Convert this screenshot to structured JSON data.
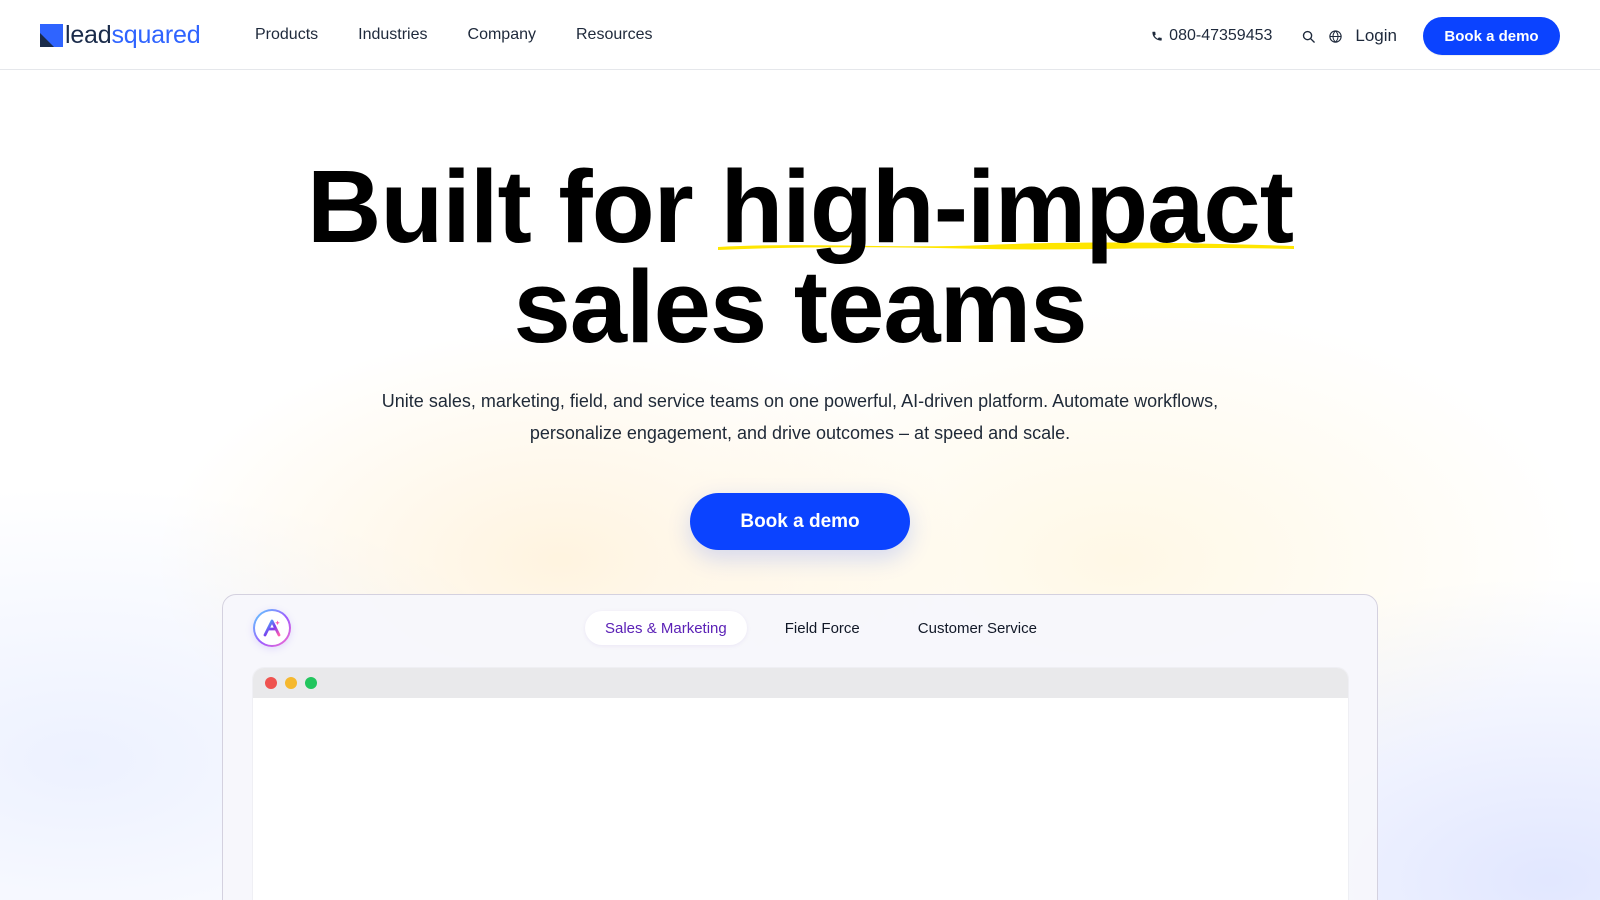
{
  "brand": {
    "logo_text_primary": "lead",
    "logo_text_secondary": "squared",
    "colors": {
      "navy": "#1a2b4a",
      "blue": "#2f64ff",
      "accent": "#0b43ff",
      "highlight": "#ffe600",
      "purple": "#5b21b6"
    }
  },
  "navbar": {
    "menu": [
      {
        "label": "Products"
      },
      {
        "label": "Industries"
      },
      {
        "label": "Company"
      },
      {
        "label": "Resources"
      }
    ],
    "phone_icon": "phone-icon",
    "phone_number": "080-47359453",
    "search_icon": "search-icon",
    "globe_icon": "globe-icon",
    "login_label": "Login",
    "book_demo_label": "Book a demo"
  },
  "hero": {
    "title_prefix": "Built for ",
    "title_highlight": "high-impact",
    "title_line2": "sales teams",
    "subtitle_line1": "Unite sales, marketing, field, and service teams on one powerful, AI-driven platform. Automate workflows,",
    "subtitle_line2": "personalize engagement, and drive outcomes – at speed and scale.",
    "cta_label": "Book a demo"
  },
  "preview": {
    "badge_icon": "ai-badge-icon",
    "tabs": [
      {
        "label": "Sales & Marketing",
        "active": true
      },
      {
        "label": "Field Force",
        "active": false
      },
      {
        "label": "Customer Service",
        "active": false
      }
    ],
    "window_controls": [
      {
        "name": "close",
        "color": "#ef5350"
      },
      {
        "name": "minimize",
        "color": "#f5b82e"
      },
      {
        "name": "maximize",
        "color": "#22c55e"
      }
    ]
  }
}
